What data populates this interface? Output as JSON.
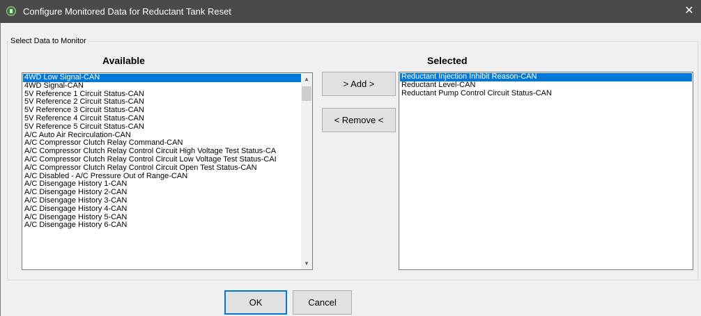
{
  "window": {
    "title": "Configure Monitored Data for Reductant Tank Reset",
    "close_glyph": "✕",
    "app_icon": "app-icon"
  },
  "group": {
    "legend": "Select Data to Monitor"
  },
  "available": {
    "heading": "Available",
    "items": [
      "4WD Low Signal-CAN",
      "4WD Signal-CAN",
      "5V Reference 1 Circuit Status-CAN",
      "5V Reference 2 Circuit Status-CAN",
      "5V Reference 3 Circuit Status-CAN",
      "5V Reference 4 Circuit Status-CAN",
      "5V Reference 5 Circuit Status-CAN",
      "A/C Auto Air Recirculation-CAN",
      "A/C Compressor Clutch Relay Command-CAN",
      "A/C Compressor Clutch Relay Control Circuit High Voltage Test Status-CA",
      "A/C Compressor Clutch Relay Control Circuit Low Voltage Test Status-CAI",
      "A/C Compressor Clutch Relay Control Circuit Open Test Status-CAN",
      "A/C Disabled - A/C Pressure Out of Range-CAN",
      "A/C Disengage History 1-CAN",
      "A/C Disengage History 2-CAN",
      "A/C Disengage History 3-CAN",
      "A/C Disengage History 4-CAN",
      "A/C Disengage History 5-CAN",
      "A/C Disengage History 6-CAN"
    ],
    "selected_index": 0,
    "scroll_up_glyph": "▲",
    "scroll_down_glyph": "▼"
  },
  "selected": {
    "heading": "Selected",
    "items": [
      "Reductant Injection Inhibit Reason-CAN",
      "Reductant Level-CAN",
      "Reductant Pump Control Circuit Status-CAN"
    ],
    "selected_index": 0
  },
  "buttons": {
    "add": "> Add >",
    "remove": "< Remove <",
    "ok": "OK",
    "cancel": "Cancel"
  },
  "colors": {
    "title_bar": "#4a4a4a",
    "selection": "#0078d7",
    "dialog_bg": "#f0f0f0"
  }
}
